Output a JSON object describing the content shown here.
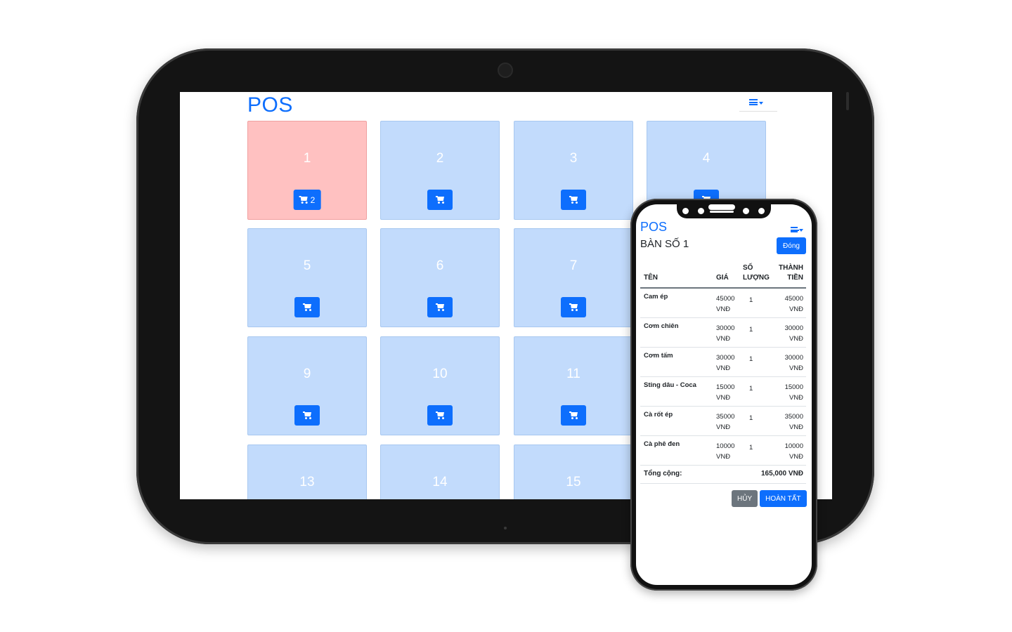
{
  "tablet": {
    "brand": "POS",
    "tables": [
      {
        "number": "1",
        "status": "occupied",
        "cart_count": "2"
      },
      {
        "number": "2",
        "status": "empty",
        "cart_count": ""
      },
      {
        "number": "3",
        "status": "empty",
        "cart_count": ""
      },
      {
        "number": "4",
        "status": "empty",
        "cart_count": ""
      },
      {
        "number": "5",
        "status": "empty",
        "cart_count": ""
      },
      {
        "number": "6",
        "status": "empty",
        "cart_count": ""
      },
      {
        "number": "7",
        "status": "empty",
        "cart_count": ""
      },
      {
        "number": "9",
        "status": "empty",
        "cart_count": ""
      },
      {
        "number": "10",
        "status": "empty",
        "cart_count": ""
      },
      {
        "number": "11",
        "status": "empty",
        "cart_count": ""
      },
      {
        "number": "13",
        "status": "empty",
        "cart_count": ""
      },
      {
        "number": "14",
        "status": "empty",
        "cart_count": ""
      },
      {
        "number": "15",
        "status": "empty",
        "cart_count": ""
      }
    ]
  },
  "phone": {
    "brand": "POS",
    "title": "BÀN SỐ 1",
    "close_label": "Đóng",
    "columns": {
      "name": "TÊN",
      "price": "GIÁ",
      "qty_line1": "SỐ",
      "qty_line2": "LƯỢNG",
      "total_line1": "THÀNH",
      "total_line2": "TIỀN"
    },
    "items": [
      {
        "name": "Cam ép",
        "price": "45000",
        "qty": "1",
        "total": "45000",
        "currency": "VNĐ"
      },
      {
        "name": "Cơm chiên",
        "price": "30000",
        "qty": "1",
        "total": "30000",
        "currency": "VNĐ"
      },
      {
        "name": "Cơm tấm",
        "price": "30000",
        "qty": "1",
        "total": "30000",
        "currency": "VNĐ"
      },
      {
        "name": "Sting dâu - Coca",
        "price": "15000",
        "qty": "1",
        "total": "15000",
        "currency": "VNĐ"
      },
      {
        "name": "Cà rốt ép",
        "price": "35000",
        "qty": "1",
        "total": "35000",
        "currency": "VNĐ"
      },
      {
        "name": "Cà phê đen",
        "price": "10000",
        "qty": "1",
        "total": "10000",
        "currency": "VNĐ"
      }
    ],
    "sum_label": "Tổng cộng:",
    "sum_value": "165,000 VNĐ",
    "cancel_label": "HỦY",
    "done_label": "HOÀN TẤT"
  },
  "colors": {
    "primary": "#0d6efd",
    "tile_empty": "#c2dbfc",
    "tile_occupied": "#ffc1c1",
    "secondary": "#6c757d"
  },
  "icons": [
    "cart-icon",
    "hamburger-menu-icon",
    "caret-down-icon"
  ]
}
